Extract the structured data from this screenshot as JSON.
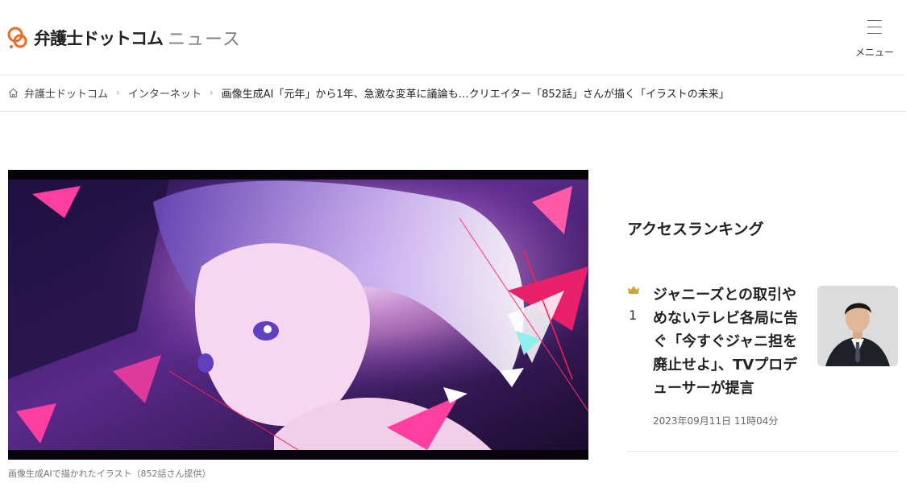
{
  "header": {
    "logo_main": "弁護士ドットコム",
    "logo_sub": "ニュース",
    "menu_label": "メニュー",
    "brand_color": "#f06b2a"
  },
  "breadcrumb": {
    "home_icon": "home-icon",
    "items": [
      "弁護士ドットコム",
      "インターネット"
    ],
    "separator": "›",
    "current": "画像生成AI「元年」から1年、急激な変革に議論も…クリエイター「852話」さんが描く「イラストの未来」"
  },
  "article": {
    "image_caption": "画像生成AIで描かれたイラスト（852話さん提供）"
  },
  "ranking": {
    "title": "アクセスランキング",
    "items": [
      {
        "rank": "1",
        "icon": "crown-icon",
        "crown_color": "#c9a53c",
        "headline": "ジャニーズとの取引やめないテレビ各局に告ぐ「今すぐジャニ担を廃止せよ」、TVプロデューサーが提言",
        "date": "2023年09月11日 11時04分"
      }
    ]
  }
}
